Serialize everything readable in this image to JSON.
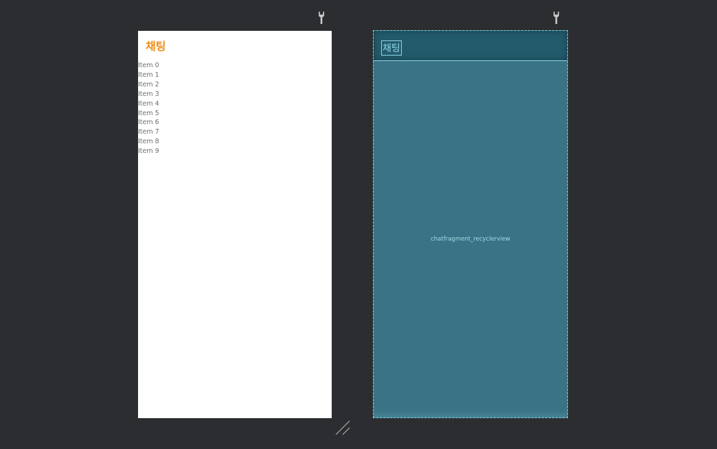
{
  "design_preview": {
    "title": "채팅",
    "items": [
      "Item 0",
      "Item 1",
      "Item 2",
      "Item 3",
      "Item 4",
      "Item 5",
      "Item 6",
      "Item 7",
      "Item 8",
      "Item 9"
    ]
  },
  "blueprint_preview": {
    "title": "채팅",
    "recyclerview_label": "chatfragment_recyclerview"
  },
  "icons": {
    "design_toolbar_icon": "wrench-icon",
    "blueprint_toolbar_icon": "wrench-icon",
    "resize_handle": "resize-handle-icon"
  },
  "colors": {
    "canvas_background": "#2c2d30",
    "title_accent": "#f08c16",
    "blueprint_fill": "#3a7385",
    "blueprint_outline": "#8fdbe8"
  }
}
